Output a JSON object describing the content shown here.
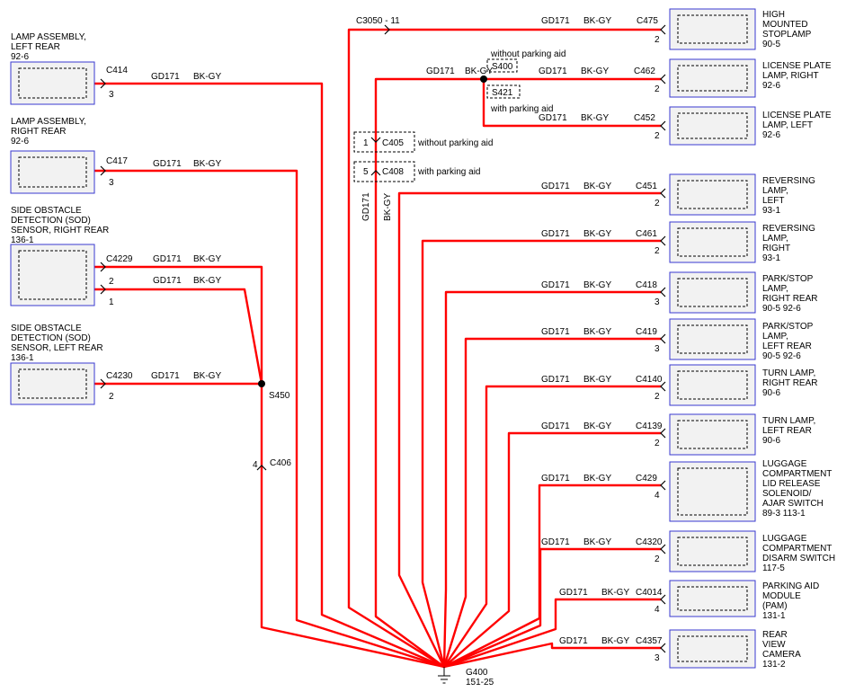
{
  "wire": {
    "circuit": "GD171",
    "color": "BK-GY",
    "hex": "#ff0000"
  },
  "ground": {
    "id": "G400",
    "ref": "151-25"
  },
  "left_components": [
    {
      "key": "lamp-assembly-left-rear",
      "lines": [
        "LAMP ASSEMBLY,",
        "LEFT REAR",
        "92-6"
      ],
      "connector": "C414",
      "pin": "3",
      "circuit": "GD171",
      "color": "BK-GY"
    },
    {
      "key": "lamp-assembly-right-rear",
      "lines": [
        "LAMP ASSEMBLY,",
        "RIGHT REAR",
        "92-6"
      ],
      "connector": "C417",
      "pin": "3",
      "circuit": "GD171",
      "color": "BK-GY"
    },
    {
      "key": "sod-sensor-right-rear",
      "lines": [
        "SIDE OBSTACLE",
        "DETECTION (SOD)",
        "SENSOR, RIGHT REAR",
        "136-1"
      ],
      "connector": "C4229",
      "pins": [
        "2",
        "1"
      ],
      "circuit": "GD171",
      "color": "BK-GY"
    },
    {
      "key": "sod-sensor-left-rear",
      "lines": [
        "SIDE OBSTACLE",
        "DETECTION (SOD)",
        "SENSOR, LEFT REAR",
        "136-1"
      ],
      "connector": "C4230",
      "pin": "2",
      "circuit": "GD171",
      "color": "BK-GY"
    }
  ],
  "splices": {
    "s450": "S450",
    "s400": "S400",
    "s421": "S421"
  },
  "inline_connectors": {
    "c406": {
      "id": "C406",
      "pin": "4"
    },
    "c3050": {
      "id": "C3050",
      "pin": "11",
      "label": "C3050 - 11"
    },
    "c405": {
      "id": "C405",
      "pin": "1",
      "note": "without parking aid"
    },
    "c408": {
      "id": "C408",
      "pin": "5",
      "note": "with parking aid"
    }
  },
  "notes": {
    "without_parking_aid": "without parking aid",
    "with_parking_aid": "with parking aid"
  },
  "right_components": [
    {
      "key": "high-mounted-stoplamp",
      "lines": [
        "HIGH",
        "MOUNTED",
        "STOPLAMP",
        "90-5"
      ],
      "connector": "C475",
      "pin": "2",
      "circuit": "GD171",
      "color": "BK-GY"
    },
    {
      "key": "license-plate-lamp-right",
      "lines": [
        "LICENSE PLATE",
        "LAMP, RIGHT",
        "92-6"
      ],
      "connector": "C462",
      "pin": "2",
      "circuit": "GD171",
      "color": "BK-GY"
    },
    {
      "key": "license-plate-lamp-left",
      "lines": [
        "LICENSE PLATE",
        "LAMP, LEFT",
        "92-6"
      ],
      "connector": "C452",
      "pin": "2",
      "circuit": "GD171",
      "color": "BK-GY"
    },
    {
      "key": "reversing-lamp-left",
      "lines": [
        "REVERSING",
        "LAMP,",
        "LEFT",
        "93-1"
      ],
      "connector": "C451",
      "pin": "2",
      "circuit": "GD171",
      "color": "BK-GY"
    },
    {
      "key": "reversing-lamp-right",
      "lines": [
        "REVERSING",
        "LAMP,",
        "RIGHT",
        "93-1"
      ],
      "connector": "C461",
      "pin": "2",
      "circuit": "GD171",
      "color": "BK-GY"
    },
    {
      "key": "park-stop-lamp-right-rear",
      "lines": [
        "PARK/STOP",
        "LAMP,",
        "RIGHT REAR",
        "90-5   92-6"
      ],
      "connector": "C418",
      "pin": "3",
      "circuit": "GD171",
      "color": "BK-GY"
    },
    {
      "key": "park-stop-lamp-left-rear",
      "lines": [
        "PARK/STOP",
        "LAMP,",
        "LEFT REAR",
        "90-5   92-6"
      ],
      "connector": "C419",
      "pin": "3",
      "circuit": "GD171",
      "color": "BK-GY"
    },
    {
      "key": "turn-lamp-right-rear",
      "lines": [
        "TURN LAMP,",
        "RIGHT REAR",
        "90-6"
      ],
      "connector": "C4140",
      "pin": "2",
      "circuit": "GD171",
      "color": "BK-GY"
    },
    {
      "key": "turn-lamp-left-rear",
      "lines": [
        "TURN LAMP,",
        "LEFT REAR",
        "90-6"
      ],
      "connector": "C4139",
      "pin": "2",
      "circuit": "GD171",
      "color": "BK-GY"
    },
    {
      "key": "luggage-lid-release-solenoid",
      "lines": [
        "LUGGAGE",
        "COMPARTMENT",
        "LID RELEASE",
        "SOLENOID/",
        "AJAR SWITCH",
        "89-3     113-1"
      ],
      "connector": "C429",
      "pin": "4",
      "circuit": "GD171",
      "color": "BK-GY"
    },
    {
      "key": "luggage-disarm-switch",
      "lines": [
        "LUGGAGE",
        "COMPARTMENT",
        "DISARM SWITCH",
        "117-5"
      ],
      "connector": "C4320",
      "pin": "2",
      "circuit": "GD171",
      "color": "BK-GY"
    },
    {
      "key": "parking-aid-module",
      "lines": [
        "PARKING AID",
        "MODULE",
        "(PAM)",
        "131-1"
      ],
      "connector": "C4014",
      "pin": "4",
      "circuit": "GD171",
      "color": "BK-GY"
    },
    {
      "key": "rear-view-camera",
      "lines": [
        "REAR",
        "VIEW",
        "CAMERA",
        "131-2"
      ],
      "connector": "C4357",
      "pin": "3",
      "circuit": "GD171",
      "color": "BK-GY"
    }
  ]
}
